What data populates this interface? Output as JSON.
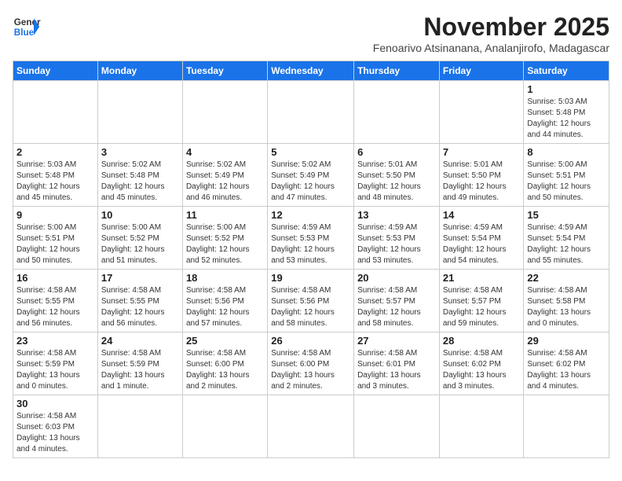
{
  "header": {
    "logo_general": "General",
    "logo_blue": "Blue",
    "month": "November 2025",
    "location": "Fenoarivo Atsinanana, Analanjirofo, Madagascar"
  },
  "weekdays": [
    "Sunday",
    "Monday",
    "Tuesday",
    "Wednesday",
    "Thursday",
    "Friday",
    "Saturday"
  ],
  "weeks": [
    [
      {
        "day": "",
        "info": ""
      },
      {
        "day": "",
        "info": ""
      },
      {
        "day": "",
        "info": ""
      },
      {
        "day": "",
        "info": ""
      },
      {
        "day": "",
        "info": ""
      },
      {
        "day": "",
        "info": ""
      },
      {
        "day": "1",
        "info": "Sunrise: 5:03 AM\nSunset: 5:48 PM\nDaylight: 12 hours\nand 44 minutes."
      }
    ],
    [
      {
        "day": "2",
        "info": "Sunrise: 5:03 AM\nSunset: 5:48 PM\nDaylight: 12 hours\nand 45 minutes."
      },
      {
        "day": "3",
        "info": "Sunrise: 5:02 AM\nSunset: 5:48 PM\nDaylight: 12 hours\nand 45 minutes."
      },
      {
        "day": "4",
        "info": "Sunrise: 5:02 AM\nSunset: 5:49 PM\nDaylight: 12 hours\nand 46 minutes."
      },
      {
        "day": "5",
        "info": "Sunrise: 5:02 AM\nSunset: 5:49 PM\nDaylight: 12 hours\nand 47 minutes."
      },
      {
        "day": "6",
        "info": "Sunrise: 5:01 AM\nSunset: 5:50 PM\nDaylight: 12 hours\nand 48 minutes."
      },
      {
        "day": "7",
        "info": "Sunrise: 5:01 AM\nSunset: 5:50 PM\nDaylight: 12 hours\nand 49 minutes."
      },
      {
        "day": "8",
        "info": "Sunrise: 5:00 AM\nSunset: 5:51 PM\nDaylight: 12 hours\nand 50 minutes."
      }
    ],
    [
      {
        "day": "9",
        "info": "Sunrise: 5:00 AM\nSunset: 5:51 PM\nDaylight: 12 hours\nand 50 minutes."
      },
      {
        "day": "10",
        "info": "Sunrise: 5:00 AM\nSunset: 5:52 PM\nDaylight: 12 hours\nand 51 minutes."
      },
      {
        "day": "11",
        "info": "Sunrise: 5:00 AM\nSunset: 5:52 PM\nDaylight: 12 hours\nand 52 minutes."
      },
      {
        "day": "12",
        "info": "Sunrise: 4:59 AM\nSunset: 5:53 PM\nDaylight: 12 hours\nand 53 minutes."
      },
      {
        "day": "13",
        "info": "Sunrise: 4:59 AM\nSunset: 5:53 PM\nDaylight: 12 hours\nand 53 minutes."
      },
      {
        "day": "14",
        "info": "Sunrise: 4:59 AM\nSunset: 5:54 PM\nDaylight: 12 hours\nand 54 minutes."
      },
      {
        "day": "15",
        "info": "Sunrise: 4:59 AM\nSunset: 5:54 PM\nDaylight: 12 hours\nand 55 minutes."
      }
    ],
    [
      {
        "day": "16",
        "info": "Sunrise: 4:58 AM\nSunset: 5:55 PM\nDaylight: 12 hours\nand 56 minutes."
      },
      {
        "day": "17",
        "info": "Sunrise: 4:58 AM\nSunset: 5:55 PM\nDaylight: 12 hours\nand 56 minutes."
      },
      {
        "day": "18",
        "info": "Sunrise: 4:58 AM\nSunset: 5:56 PM\nDaylight: 12 hours\nand 57 minutes."
      },
      {
        "day": "19",
        "info": "Sunrise: 4:58 AM\nSunset: 5:56 PM\nDaylight: 12 hours\nand 58 minutes."
      },
      {
        "day": "20",
        "info": "Sunrise: 4:58 AM\nSunset: 5:57 PM\nDaylight: 12 hours\nand 58 minutes."
      },
      {
        "day": "21",
        "info": "Sunrise: 4:58 AM\nSunset: 5:57 PM\nDaylight: 12 hours\nand 59 minutes."
      },
      {
        "day": "22",
        "info": "Sunrise: 4:58 AM\nSunset: 5:58 PM\nDaylight: 13 hours\nand 0 minutes."
      }
    ],
    [
      {
        "day": "23",
        "info": "Sunrise: 4:58 AM\nSunset: 5:59 PM\nDaylight: 13 hours\nand 0 minutes."
      },
      {
        "day": "24",
        "info": "Sunrise: 4:58 AM\nSunset: 5:59 PM\nDaylight: 13 hours\nand 1 minute."
      },
      {
        "day": "25",
        "info": "Sunrise: 4:58 AM\nSunset: 6:00 PM\nDaylight: 13 hours\nand 2 minutes."
      },
      {
        "day": "26",
        "info": "Sunrise: 4:58 AM\nSunset: 6:00 PM\nDaylight: 13 hours\nand 2 minutes."
      },
      {
        "day": "27",
        "info": "Sunrise: 4:58 AM\nSunset: 6:01 PM\nDaylight: 13 hours\nand 3 minutes."
      },
      {
        "day": "28",
        "info": "Sunrise: 4:58 AM\nSunset: 6:02 PM\nDaylight: 13 hours\nand 3 minutes."
      },
      {
        "day": "29",
        "info": "Sunrise: 4:58 AM\nSunset: 6:02 PM\nDaylight: 13 hours\nand 4 minutes."
      }
    ],
    [
      {
        "day": "30",
        "info": "Sunrise: 4:58 AM\nSunset: 6:03 PM\nDaylight: 13 hours\nand 4 minutes."
      },
      {
        "day": "",
        "info": ""
      },
      {
        "day": "",
        "info": ""
      },
      {
        "day": "",
        "info": ""
      },
      {
        "day": "",
        "info": ""
      },
      {
        "day": "",
        "info": ""
      },
      {
        "day": "",
        "info": ""
      }
    ]
  ]
}
